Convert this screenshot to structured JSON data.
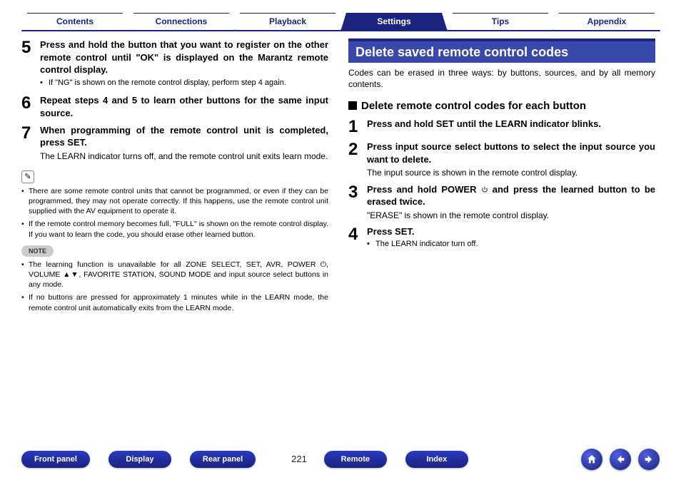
{
  "tabs": [
    {
      "label": "Contents",
      "active": false
    },
    {
      "label": "Connections",
      "active": false
    },
    {
      "label": "Playback",
      "active": false
    },
    {
      "label": "Settings",
      "active": true
    },
    {
      "label": "Tips",
      "active": false
    },
    {
      "label": "Appendix",
      "active": false
    }
  ],
  "left": {
    "steps": [
      {
        "num": "5",
        "title": "Press and hold the button that you want to register on the other remote control until \"OK\" is displayed on the Marantz remote control display.",
        "bullets": [
          "If \"NG\" is shown on the remote control display, perform step 4 again."
        ]
      },
      {
        "num": "6",
        "title": "Repeat steps 4 and 5 to learn other buttons for the same input source."
      },
      {
        "num": "7",
        "title": "When programming of the remote control unit is completed, press SET.",
        "body": "The LEARN indicator turns off, and the remote control unit exits learn mode."
      }
    ],
    "tip_bullets": [
      "There are some remote control units that cannot be programmed, or even if they can be programmed, they may not operate correctly. If this happens, use the remote control unit supplied with the AV equipment to operate it.",
      "If the remote control memory becomes full, \"FULL\" is shown on the remote control display. If you want to learn the code, you should erase other learned button."
    ],
    "note_label": "NOTE",
    "note_bullets": [
      "The learning function is unavailable for all ZONE SELECT, SET, AVR, POWER ⏻, VOLUME ▲▼, FAVORITE STATION, SOUND MODE and input source select buttons in any mode.",
      "If no buttons are pressed for approximately 1 minutes while in the LEARN mode, the remote control unit automatically exits from the LEARN mode."
    ]
  },
  "right": {
    "section_title": "Delete saved remote control codes",
    "intro": "Codes can be erased in three ways: by buttons, sources, and by all memory contents.",
    "sub_head": "Delete remote control codes for each button",
    "steps": [
      {
        "num": "1",
        "title": "Press and hold SET until the LEARN indicator blinks."
      },
      {
        "num": "2",
        "title": "Press input source select buttons to select the input source you want to delete.",
        "body": "The input source is shown in the remote control display."
      },
      {
        "num": "3",
        "title_pre": "Press and hold POWER ",
        "title_post": " and press the learned button to be erased twice.",
        "body": "\"ERASE\" is shown in the remote control display."
      },
      {
        "num": "4",
        "title": "Press SET.",
        "bullets": [
          "The LEARN indicator turn off."
        ]
      }
    ]
  },
  "footer": {
    "buttons": [
      "Front panel",
      "Display",
      "Rear panel"
    ],
    "page": "221",
    "buttons2": [
      "Remote",
      "Index"
    ]
  }
}
